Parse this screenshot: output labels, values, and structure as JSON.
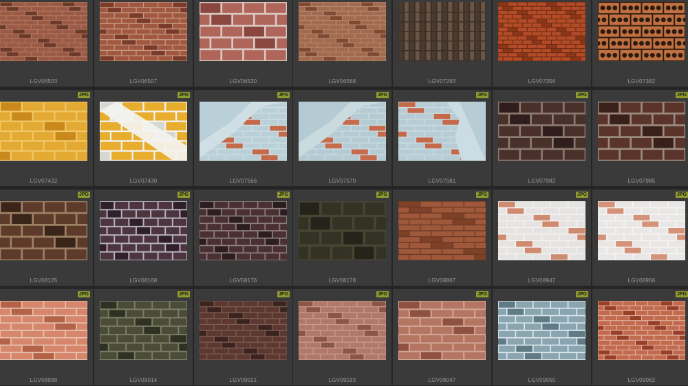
{
  "grid": {
    "badge_label": "JPG",
    "items": [
      {
        "id": "LGV06503",
        "pattern": "brick",
        "base": "#9a5a45",
        "mortar": "#b37b62",
        "dark": "#6c3a2b",
        "rows": 13,
        "cols": 7
      },
      {
        "id": "LGV06507",
        "pattern": "brick",
        "base": "#a15840",
        "mortar": "#c79a84",
        "dark": "#7a3b2a",
        "rows": 11,
        "cols": 6
      },
      {
        "id": "LGV06530",
        "pattern": "brick",
        "base": "#b0655b",
        "mortar": "#d9c7c0",
        "dark": "#8a4740",
        "rows": 5,
        "cols": 4
      },
      {
        "id": "LGV06568",
        "pattern": "brick",
        "base": "#a26a4e",
        "mortar": "#b78a70",
        "dark": "#7e4a34",
        "rows": 13,
        "cols": 7
      },
      {
        "id": "LGV07293",
        "pattern": "vertical",
        "base": "#6b5544",
        "mortar": "#3a3029",
        "dark": "#4b3a2d",
        "rows": 1,
        "cols": 16
      },
      {
        "id": "LGV07356",
        "pattern": "brick",
        "base": "#b24b26",
        "mortar": "#6a2a16",
        "dark": "#8c3618",
        "rows": 14,
        "cols": 9
      },
      {
        "id": "LGV07382",
        "pattern": "holes",
        "base": "#c07040",
        "mortar": "#2a1a10",
        "dark": "#7e3f1f",
        "rows": 5,
        "cols": 4
      },
      {
        "id": "LGV07422",
        "pattern": "brick",
        "base": "#e3a932",
        "mortar": "#f0c766",
        "dark": "#c98a1b",
        "rows": 6,
        "cols": 4
      },
      {
        "id": "LGV07430",
        "pattern": "stripe",
        "base": "#e8ad2d",
        "mortar": "#f3f3f0",
        "dark": "#d7d7d2",
        "rows": 6,
        "cols": 4
      },
      {
        "id": "LGV07566",
        "pattern": "plaster",
        "base": "#b9d0d8",
        "mortar": "#cfdfe4",
        "dark": "#c46a4a",
        "rows": 10,
        "cols": 5
      },
      {
        "id": "LGV07570",
        "pattern": "plaster",
        "base": "#b4cbd3",
        "mortar": "#cadbe0",
        "dark": "#c66c4c",
        "rows": 10,
        "cols": 5
      },
      {
        "id": "LGV07581",
        "pattern": "plaster-right",
        "base": "#b7ccd4",
        "mortar": "#cbdde2",
        "dark": "#c46a4a",
        "rows": 10,
        "cols": 5
      },
      {
        "id": "LGV07982",
        "pattern": "brick",
        "base": "#4a302b",
        "mortar": "#8b7a70",
        "dark": "#2f1e1b",
        "rows": 5,
        "cols": 4
      },
      {
        "id": "LGV07985",
        "pattern": "brick",
        "base": "#5a332b",
        "mortar": "#9c8a7d",
        "dark": "#3a201a",
        "rows": 5,
        "cols": 4
      },
      {
        "id": "LGV08125",
        "pattern": "brick",
        "base": "#5d3a2a",
        "mortar": "#9c8264",
        "dark": "#3b2419",
        "rows": 5,
        "cols": 4
      },
      {
        "id": "LGV08168",
        "pattern": "brick",
        "base": "#4d3540",
        "mortar": "#b8b3c0",
        "dark": "#2f2029",
        "rows": 7,
        "cols": 6
      },
      {
        "id": "LGV08176",
        "pattern": "brick",
        "base": "#4a3033",
        "mortar": "#8d7f80",
        "dark": "#2c1d20",
        "rows": 8,
        "cols": 6
      },
      {
        "id": "LGV08178",
        "pattern": "stone",
        "base": "#3d3a2c",
        "mortar": "#5a5640",
        "dark": "#25241b",
        "rows": 4,
        "cols": 4
      },
      {
        "id": "LGV08867",
        "pattern": "brick",
        "base": "#a0583a",
        "mortar": "#6a3a25",
        "dark": "#7e4027",
        "rows": 10,
        "cols": 4
      },
      {
        "id": "LGV08947",
        "pattern": "brick",
        "base": "#e6e4e2",
        "mortar": "#f4f3f1",
        "dark": "#cf8b6f",
        "rows": 9,
        "cols": 5
      },
      {
        "id": "LGV08956",
        "pattern": "brick",
        "base": "#e9e7e6",
        "mortar": "#f6f5f4",
        "dark": "#d49279",
        "rows": 9,
        "cols": 5
      },
      {
        "id": "LGV08998",
        "pattern": "brick",
        "base": "#d6866a",
        "mortar": "#e6c4b4",
        "dark": "#b46347",
        "rows": 8,
        "cols": 4
      },
      {
        "id": "LGV09014",
        "pattern": "brick",
        "base": "#4a4c38",
        "mortar": "#7c7d66",
        "dark": "#2f3122",
        "rows": 7,
        "cols": 5
      },
      {
        "id": "LGV09021",
        "pattern": "brick",
        "base": "#5c3830",
        "mortar": "#7b5c52",
        "dark": "#3b2420",
        "rows": 10,
        "cols": 6
      },
      {
        "id": "LGV09033",
        "pattern": "brick",
        "base": "#b07868",
        "mortar": "#c79a8c",
        "dark": "#8a5647",
        "rows": 10,
        "cols": 6
      },
      {
        "id": "LGV09047",
        "pattern": "brick",
        "base": "#b57563",
        "mortar": "#d2a898",
        "dark": "#8f5140",
        "rows": 7,
        "cols": 4
      },
      {
        "id": "LGV09055",
        "pattern": "brick",
        "base": "#8aa4b0",
        "mortar": "#dde8ec",
        "dark": "#607a86",
        "rows": 8,
        "cols": 5
      },
      {
        "id": "LGV09062",
        "pattern": "brick",
        "base": "#c16a4e",
        "mortar": "#e2b09e",
        "dark": "#983f2a",
        "rows": 12,
        "cols": 7
      }
    ]
  }
}
